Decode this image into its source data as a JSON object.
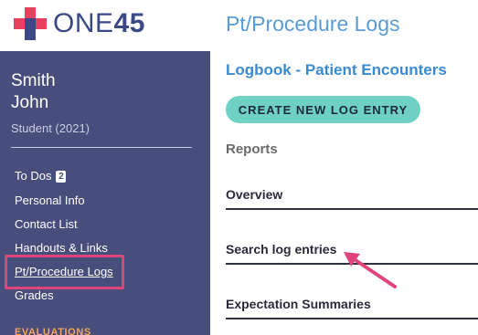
{
  "brand": {
    "logo_light": "ONE",
    "logo_bold": "45",
    "cross_color": "#e8405f",
    "accent": "#474e7c"
  },
  "sidebar": {
    "user_last": "Smith",
    "user_first": "John",
    "user_role": "Student (2021)",
    "nav": [
      {
        "label": "To Dos",
        "badge": "2"
      },
      {
        "label": "Personal Info"
      },
      {
        "label": "Contact List"
      },
      {
        "label": "Handouts & Links"
      },
      {
        "label": "Pt/Procedure Logs",
        "active": true
      },
      {
        "label": "Grades"
      }
    ],
    "section_heading": "EVALUATIONS"
  },
  "main": {
    "title": "Pt/Procedure Logs",
    "subtitle": "Logbook - Patient Encounters",
    "create_button": "CREATE NEW LOG ENTRY",
    "reports_heading": "Reports",
    "reports": [
      {
        "label": "Overview"
      },
      {
        "label": "Search log entries"
      },
      {
        "label": "Expectation Summaries"
      }
    ]
  },
  "annotation": {
    "highlight_color": "#e0457a",
    "arrow_color": "#e0457a"
  }
}
